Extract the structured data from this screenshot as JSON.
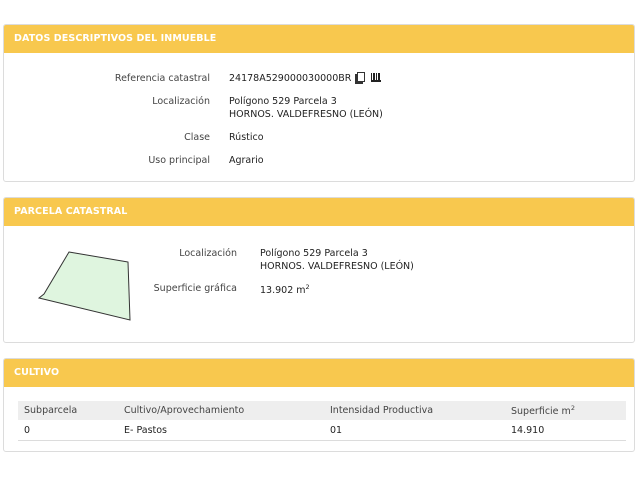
{
  "datos": {
    "title": "DATOS DESCRIPTIVOS DEL INMUEBLE",
    "ref_label": "Referencia catastral",
    "ref_value": "24178A529000030000BR",
    "loc_label": "Localización",
    "loc_line1": "Polígono 529 Parcela 3",
    "loc_line2": "HORNOS. VALDEFRESNO (LEÓN)",
    "clase_label": "Clase",
    "clase_value": "Rústico",
    "uso_label": "Uso principal",
    "uso_value": "Agrario"
  },
  "parcela": {
    "title": "PARCELA CATASTRAL",
    "loc_label": "Localización",
    "loc_line1": "Polígono 529 Parcela 3",
    "loc_line2": "HORNOS. VALDEFRESNO (LEÓN)",
    "sup_label": "Superficie gráfica",
    "sup_value": "13.902 m",
    "sup_unit_exp": "2"
  },
  "cultivo": {
    "title": "CULTIVO",
    "headers": [
      "Subparcela",
      "Cultivo/Aprovechamiento",
      "Intensidad Productiva",
      "Superficie m"
    ],
    "header_exp": "2",
    "rows": [
      [
        "0",
        "E- Pastos",
        "01",
        "14.910"
      ]
    ]
  },
  "colors": {
    "header_bg": "#f8c84e",
    "parcel_fill": "#dff5df",
    "parcel_stroke": "#333333"
  },
  "icons": [
    "copy-icon",
    "barcode-icon"
  ]
}
